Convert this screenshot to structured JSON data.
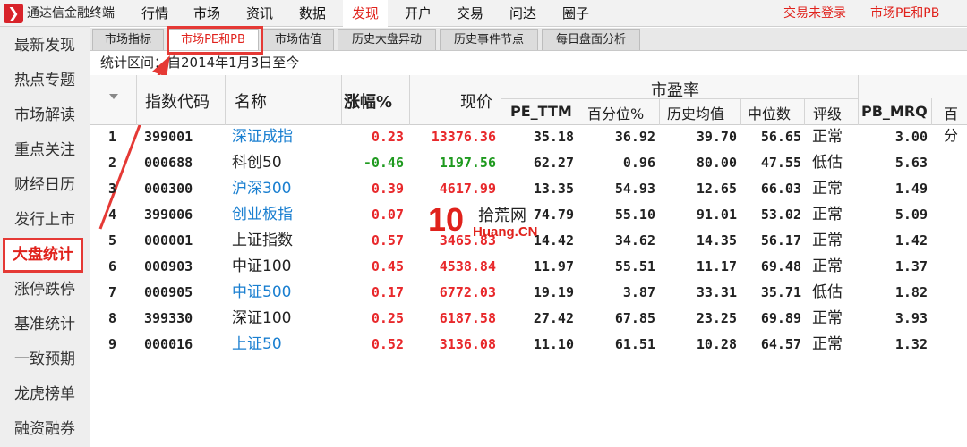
{
  "app": {
    "title": "通达信金融终端",
    "logo_icon": "tdx-logo-icon"
  },
  "menu": [
    "行情",
    "市场",
    "资讯",
    "数据",
    "发现",
    "开户",
    "交易",
    "问达",
    "圈子"
  ],
  "menu_active": "发现",
  "top_right": {
    "login_status": "交易未登录",
    "page_label": "市场PE和PB"
  },
  "sidebar": [
    "最新发现",
    "热点专题",
    "市场解读",
    "重点关注",
    "财经日历",
    "发行上市",
    "大盘统计",
    "涨停跌停",
    "基准统计",
    "一致预期",
    "龙虎榜单",
    "融资融券"
  ],
  "sidebar_active": "大盘统计",
  "tabs": [
    "市场指标",
    "市场PE和PB",
    "市场估值",
    "历史大盘异动",
    "历史事件节点",
    "每日盘面分析"
  ],
  "tabs_active": "市场PE和PB",
  "range_text": "统计区间：自2014年1月3日至今",
  "columns": {
    "code": "指数代码",
    "name": "名称",
    "change": "涨幅%",
    "price": "现价",
    "group_pe": "市盈率",
    "pe_ttm": "PE_TTM",
    "percentile": "百分位%",
    "hist_avg": "历史均值",
    "median": "中位数",
    "rating": "评级",
    "pb_mrq": "PB_MRQ",
    "pb_pct_partial": "百分"
  },
  "rows": [
    {
      "idx": "1",
      "code": "399001",
      "name": "深证成指",
      "name_color": "blue",
      "change": "0.23",
      "price": "13376.36",
      "pe": "35.18",
      "pct": "36.92",
      "avg": "39.70",
      "median": "56.65",
      "rating": "正常",
      "pb": "3.00"
    },
    {
      "idx": "2",
      "code": "000688",
      "name": "科创50",
      "name_color": "dark",
      "change": "-0.46",
      "price": "1197.56",
      "pe": "62.27",
      "pct": "0.96",
      "avg": "80.00",
      "median": "47.55",
      "rating": "低估",
      "pb": "5.63"
    },
    {
      "idx": "3",
      "code": "000300",
      "name": "沪深300",
      "name_color": "blue",
      "change": "0.39",
      "price": "4617.99",
      "pe": "13.35",
      "pct": "54.93",
      "avg": "12.65",
      "median": "66.03",
      "rating": "正常",
      "pb": "1.49"
    },
    {
      "idx": "4",
      "code": "399006",
      "name": "创业板指",
      "name_color": "blue",
      "change": "0.07",
      "price": "",
      "pe": "74.79",
      "pct": "55.10",
      "avg": "91.01",
      "median": "53.02",
      "rating": "正常",
      "pb": "5.09"
    },
    {
      "idx": "5",
      "code": "000001",
      "name": "上证指数",
      "name_color": "dark",
      "change": "0.57",
      "price": "3465.83",
      "pe": "14.42",
      "pct": "34.62",
      "avg": "14.35",
      "median": "56.17",
      "rating": "正常",
      "pb": "1.42"
    },
    {
      "idx": "6",
      "code": "000903",
      "name": "中证100",
      "name_color": "dark",
      "change": "0.45",
      "price": "4538.84",
      "pe": "11.97",
      "pct": "55.51",
      "avg": "11.17",
      "median": "69.48",
      "rating": "正常",
      "pb": "1.37"
    },
    {
      "idx": "7",
      "code": "000905",
      "name": "中证500",
      "name_color": "blue",
      "change": "0.17",
      "price": "6772.03",
      "pe": "19.19",
      "pct": "3.87",
      "avg": "33.31",
      "median": "35.71",
      "rating": "低估",
      "pb": "1.82"
    },
    {
      "idx": "8",
      "code": "399330",
      "name": "深证100",
      "name_color": "dark",
      "change": "0.25",
      "price": "6187.58",
      "pe": "27.42",
      "pct": "67.85",
      "avg": "23.25",
      "median": "69.89",
      "rating": "正常",
      "pb": "3.93"
    },
    {
      "idx": "9",
      "code": "000016",
      "name": "上证50",
      "name_color": "blue",
      "change": "0.52",
      "price": "3136.08",
      "pe": "11.10",
      "pct": "61.51",
      "avg": "10.28",
      "median": "64.57",
      "rating": "正常",
      "pb": "1.32"
    }
  ],
  "watermark": {
    "mark": "10",
    "cn": "拾荒网",
    "en": "Huang.CN"
  },
  "colors": {
    "accent_red": "#e0221c",
    "up_red": "#e8282b",
    "down_green": "#1f9a1f",
    "link_blue": "#1a7fd0",
    "highlight_box": "#e53935"
  }
}
